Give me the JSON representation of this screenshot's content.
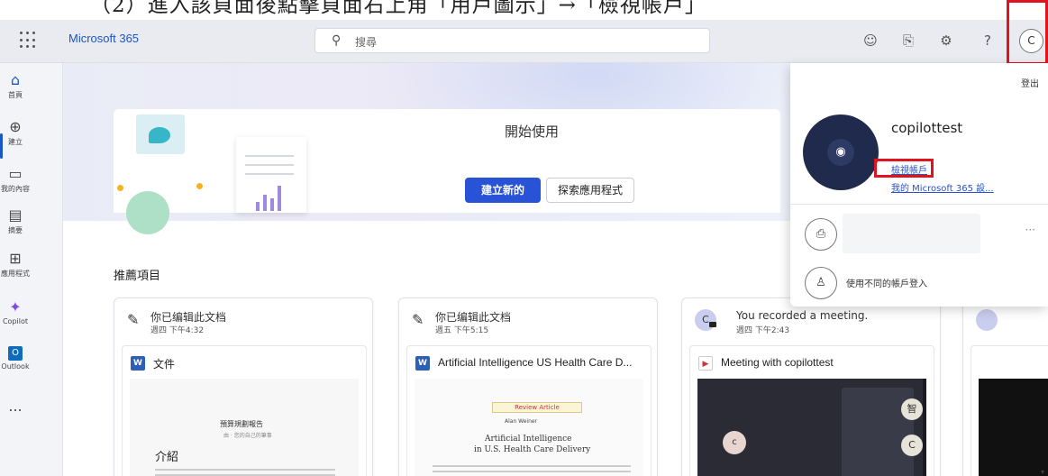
{
  "caption": "（2）進入該頁面後點擊頁面右上角「用戶圖示」→「檢視帳戶」",
  "header": {
    "app_title": "Microsoft 365",
    "search_placeholder": "搜尋",
    "avatar_initial": "C",
    "icons": [
      "smiley-icon",
      "feedback-icon",
      "settings-icon",
      "help-icon"
    ],
    "help_label": "?"
  },
  "rail": {
    "items": [
      {
        "label": "首頁",
        "icon": "home-icon"
      },
      {
        "label": "建立",
        "icon": "create-icon"
      },
      {
        "label": "我的內容",
        "icon": "folder-icon"
      },
      {
        "label": "摘要",
        "icon": "feed-icon"
      },
      {
        "label": "應用程式",
        "icon": "apps-icon"
      },
      {
        "label": "Copilot",
        "icon": "copilot-icon"
      },
      {
        "label": "Outlook",
        "icon": "outlook-icon"
      }
    ],
    "more": "..."
  },
  "hero": {
    "title": "開始使用",
    "primary_button": "建立新的",
    "secondary_button": "探索應用程式"
  },
  "recommended": {
    "title": "推薦項目",
    "cards": [
      {
        "activity": "你已编辑此文档",
        "time": "週四 下午4:32",
        "file_name": "文件",
        "file_type": "W"
      },
      {
        "activity": "你已编辑此文档",
        "time": "週五 下午5:15",
        "file_name": "Artificial Intelligence US Health Care D...",
        "file_type": "W"
      },
      {
        "activity": "You recorded a meeting.",
        "time": "週四 下午2:43",
        "file_name": "Meeting with copilottest",
        "file_type": "▶",
        "avatar": "C"
      }
    ]
  },
  "previews": {
    "doc1_heading": "預算規劃報告",
    "doc1_sub": "由 · 您的自己的筆事",
    "doc1_section": "介紹",
    "doc2_banner": "Review Article",
    "doc2_title_line1": "Artificial Intelligence",
    "doc2_title_line2": "in U.S. Health Care Delivery",
    "doc2_author": "Alan Weiner",
    "meeting_badge_1": "智",
    "meeting_badge_2": "C"
  },
  "account_panel": {
    "logout": "登出",
    "name": "copilottest",
    "view_account": "檢視帳戶",
    "settings_link": "我的 Microsoft 365 設...",
    "more": "···",
    "switch_account": "使用不同的帳戶登入"
  },
  "colors": {
    "accent": "#2953d6",
    "highlight": "#e0141e",
    "rail_bg": "#f3f4f7",
    "avatar_bg": "#1f2a4d"
  }
}
